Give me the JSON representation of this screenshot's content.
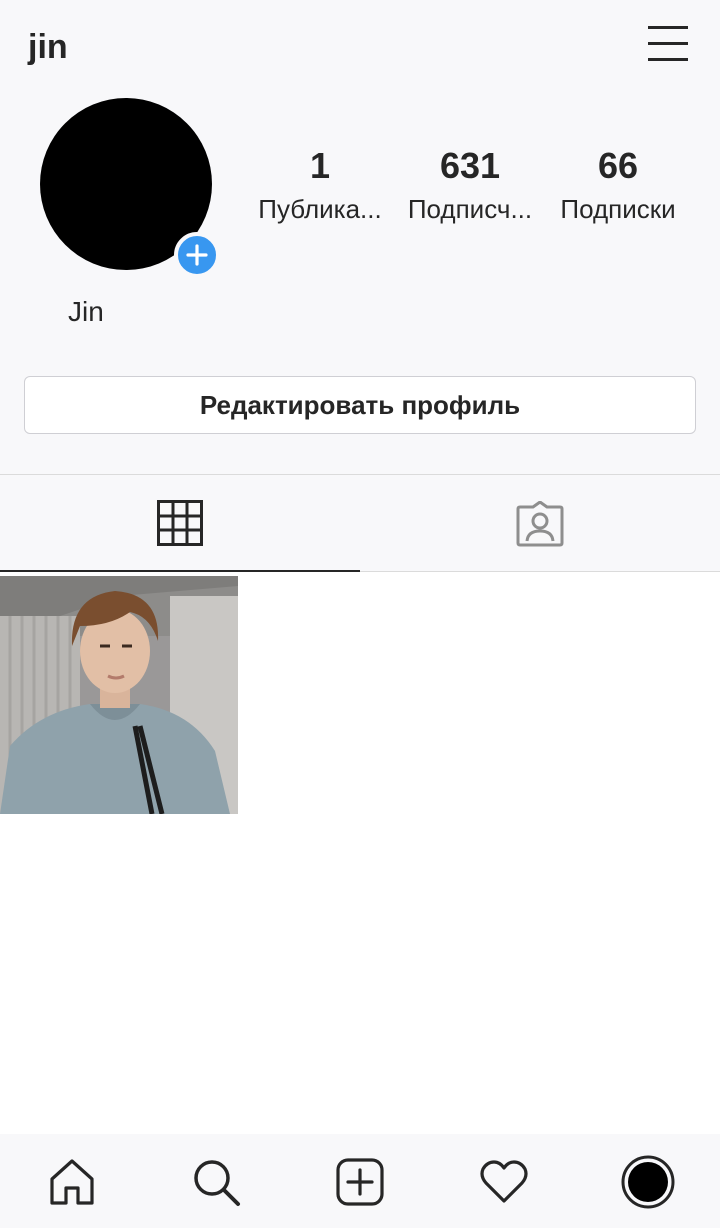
{
  "header": {
    "username": "jin"
  },
  "profile": {
    "display_name": "Jin",
    "stats": [
      {
        "value": "1",
        "label": "Публика..."
      },
      {
        "value": "631",
        "label": "Подписч..."
      },
      {
        "value": "66",
        "label": "Подписки"
      }
    ],
    "edit_button_label": "Редактировать профиль"
  },
  "tabs": [
    {
      "name": "grid",
      "icon": "grid-icon",
      "active": true
    },
    {
      "name": "tagged",
      "icon": "tagged-person-icon",
      "active": false
    }
  ],
  "posts_count_shown": 1,
  "bottom_nav": [
    "home-icon",
    "search-icon",
    "add-post-icon",
    "heart-icon",
    "profile-avatar-icon"
  ],
  "colors": {
    "accent": "#3897f0",
    "text": "#262626",
    "background": "#f8f8fa"
  }
}
